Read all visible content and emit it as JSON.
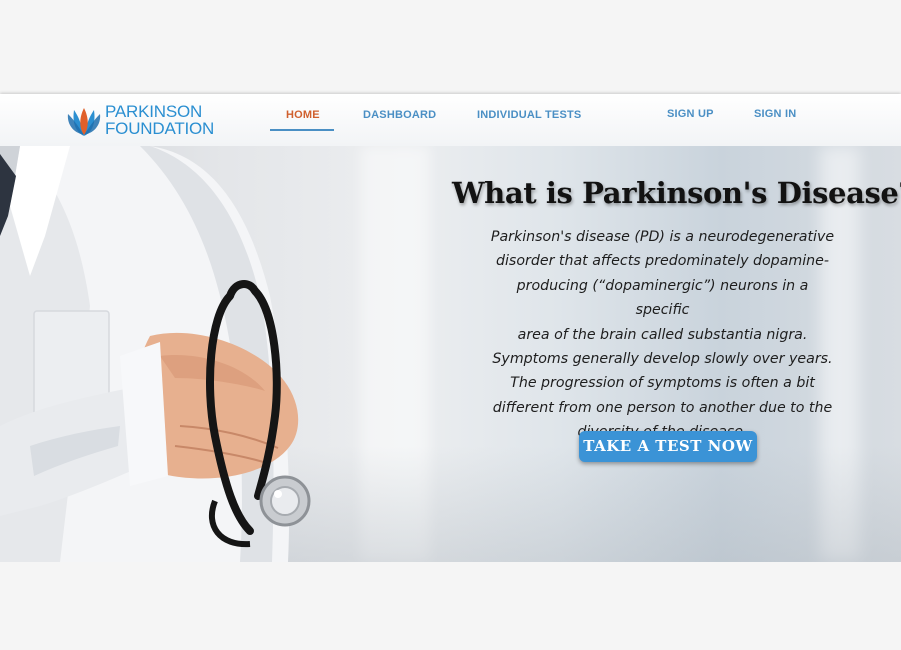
{
  "brand": {
    "logo_line1": "PARKINSON",
    "logo_line2": "FOUNDATION",
    "logo_icon": "lotus-logo-icon",
    "primary_color": "#2b8fd1",
    "accent_color": "#d0602e"
  },
  "nav": {
    "home": "HOME",
    "dashboard": "DASHBOARD",
    "individual_tests": "INDIVIDUAL TESTS",
    "sign_up": "SIGN UP",
    "sign_in": "SIGN IN",
    "active": "HOME"
  },
  "hero": {
    "title": "What is Parkinson's Disease?",
    "paragraph_lines": [
      "Parkinson's disease (PD) is a neurodegenerative",
      "disorder that affects predominately dopamine-",
      "producing (“dopaminergic”) neurons in a specific",
      "area of the brain called substantia nigra.",
      "Symptoms generally develop slowly over years.",
      "The progression of symptoms is often a bit",
      "different from one person to another due to the",
      "diversity of the disease."
    ],
    "cta_label": "TAKE A TEST NOW",
    "cta_color": "#3b93d6",
    "image_subject": "doctor-with-stethoscope"
  }
}
